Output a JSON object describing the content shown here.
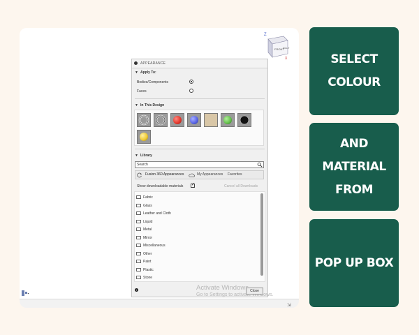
{
  "viewcube": {
    "front_label": "FRONT",
    "right_label": "RIGHT",
    "axis_z": "Z",
    "axis_x": "X"
  },
  "panel": {
    "title": "APPEARANCE",
    "apply_to": {
      "header": "Apply To:",
      "options": [
        {
          "label": "Bodies/Components",
          "selected": true
        },
        {
          "label": "Faces",
          "selected": false
        }
      ]
    },
    "in_this_design": {
      "header": "In This Design",
      "swatches": [
        {
          "name": "chrome-ring",
          "color": "#8a8a8a"
        },
        {
          "name": "chrome-ring-2",
          "color": "#9b9b9b"
        },
        {
          "name": "red",
          "color": "#e53a2f"
        },
        {
          "name": "blue",
          "color": "#5b67e8"
        },
        {
          "name": "wood-beige",
          "color": "#d9c7a7"
        },
        {
          "name": "green",
          "color": "#67c24e"
        },
        {
          "name": "black-ring",
          "color": "#1f1f1f"
        },
        {
          "name": "yellow",
          "color": "#f0cc37"
        }
      ]
    },
    "library": {
      "header": "Library",
      "search_placeholder": "Search",
      "tabs": [
        "Fusion 360 Appearances",
        "My Appearances",
        "Favorites"
      ],
      "show_downloadable_label": "Show downloadable materials",
      "show_downloadable_checked": true,
      "cancel_downloads": "Cancel all Downloads",
      "folders": [
        "Fabric",
        "Glass",
        "Leather and Cloth",
        "Liquid",
        "Metal",
        "Mirror",
        "Miscellaneous",
        "Other",
        "Paint",
        "Plastic",
        "Stone"
      ]
    },
    "info_icon": "i",
    "close_label": "Close"
  },
  "watermark": {
    "line1": "Activate Windows",
    "line2": "Go to Settings to activate Windows."
  },
  "callouts": [
    {
      "lines": [
        "SELECT",
        "COLOUR"
      ]
    },
    {
      "lines": [
        "AND MATERIAL",
        "FROM"
      ]
    },
    {
      "lines": [
        "POP UP BOX"
      ]
    }
  ],
  "colors": {
    "callout_bg": "#185d4c",
    "page_bg": "#fdf6ee"
  }
}
